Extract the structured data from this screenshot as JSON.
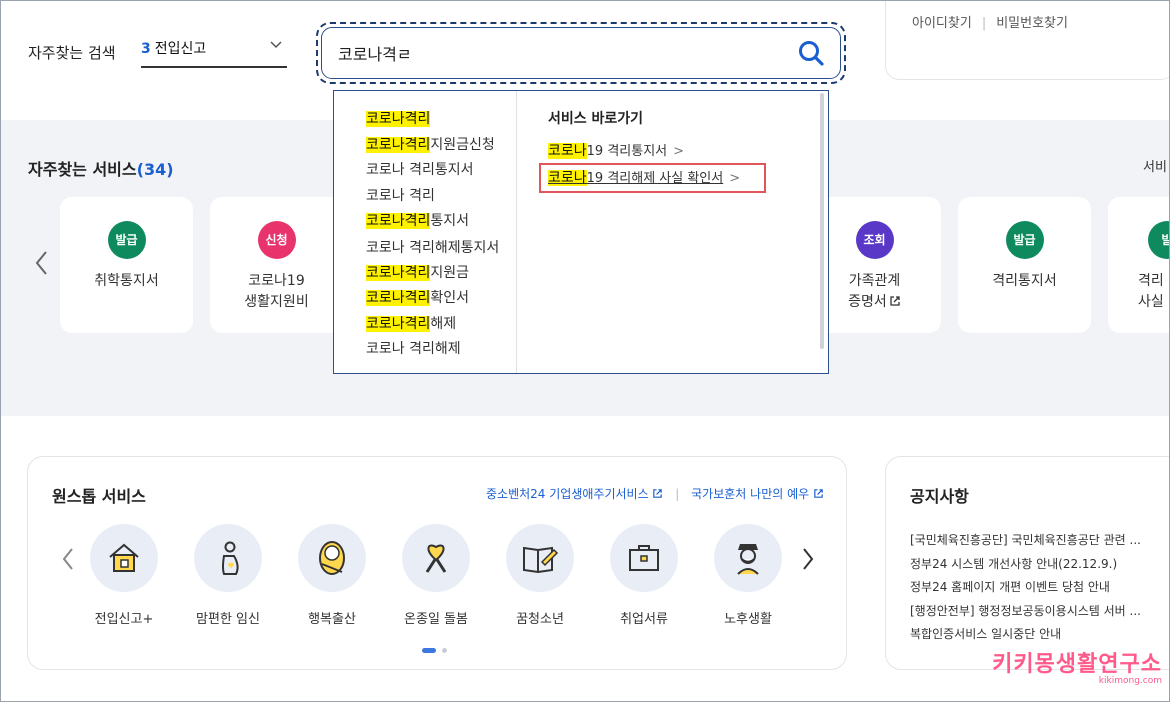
{
  "header": {
    "frequent_search_label": "자주찾는 검색",
    "frequent_select_num": "3",
    "frequent_select_text": "전입신고",
    "search_value": "코로나격ㄹ",
    "login_links": [
      "아이디찾기",
      "비밀번호찾기"
    ]
  },
  "autocomplete": {
    "suggestions": [
      {
        "hl": "코로나격리",
        "rest": ""
      },
      {
        "hl": "코로나격리",
        "rest": "지원금신청"
      },
      {
        "hl": "",
        "rest": "코로나 격리통지서"
      },
      {
        "hl": "",
        "rest": "코로나 격리"
      },
      {
        "hl": "코로나격리",
        "rest": "통지서"
      },
      {
        "hl": "",
        "rest": "코로나 격리해제통지서"
      },
      {
        "hl": "코로나격리",
        "rest": "지원금"
      },
      {
        "hl": "코로나격리",
        "rest": "확인서"
      },
      {
        "hl": "코로나격리",
        "rest": "해제"
      },
      {
        "hl": "",
        "rest": "코로나 격리해제"
      }
    ],
    "shortcut_title": "서비스 바로가기",
    "shortcuts": [
      {
        "hl": "코로나",
        "rest": "19 격리통지서",
        "arrow": ">"
      },
      {
        "hl": "코로나",
        "rest": "19 격리해제 사실 확인서",
        "arrow": ">"
      }
    ]
  },
  "frequent_services": {
    "title": "자주찾는 서비스",
    "count": "(34)",
    "right_label": "서비",
    "prev_arrow": "‹",
    "cards": [
      {
        "badge": "발급",
        "name": "취학통지서",
        "color": "#0f8a5f"
      },
      {
        "badge": "신청",
        "name": "코로나19\n생활지원비",
        "color": "#e8336d"
      },
      {
        "badge": "조회",
        "name": "가족관계\n증명서",
        "color": "#5a38c7"
      },
      {
        "badge": "발급",
        "name": "격리통지서",
        "color": "#0f8a5f"
      },
      {
        "badge": "발",
        "name": "격리\n사실",
        "color": "#0f8a5f"
      }
    ]
  },
  "onestop": {
    "title": "원스톱 서비스",
    "links": [
      "중소벤처24 기업생애주기서비스",
      "국가보훈처 나만의 예우"
    ],
    "items": [
      {
        "label": "전입신고+",
        "icon": "house-icon"
      },
      {
        "label": "맘편한 임신",
        "icon": "pregnancy-icon"
      },
      {
        "label": "행복출산",
        "icon": "baby-icon"
      },
      {
        "label": "온종일 돌봄",
        "icon": "ribbon-icon"
      },
      {
        "label": "꿈청소년",
        "icon": "book-icon"
      },
      {
        "label": "취업서류",
        "icon": "briefcase-icon"
      },
      {
        "label": "노후생활",
        "icon": "elder-icon"
      }
    ]
  },
  "notice": {
    "title": "공지사항",
    "items": [
      "[국민체육진흥공단] 국민체육진흥공단 관련 ...",
      "정부24 시스템 개선사항 안내(22.12.9.)",
      "정부24 홈페이지 개편 이벤트 당첨 안내",
      "[행정안전부] 행정정보공동이용시스템 서버 ...",
      "복합인증서비스 일시중단 안내"
    ]
  },
  "watermark": {
    "main": "키키몽생활연구소",
    "sub": "kikimong.com"
  }
}
